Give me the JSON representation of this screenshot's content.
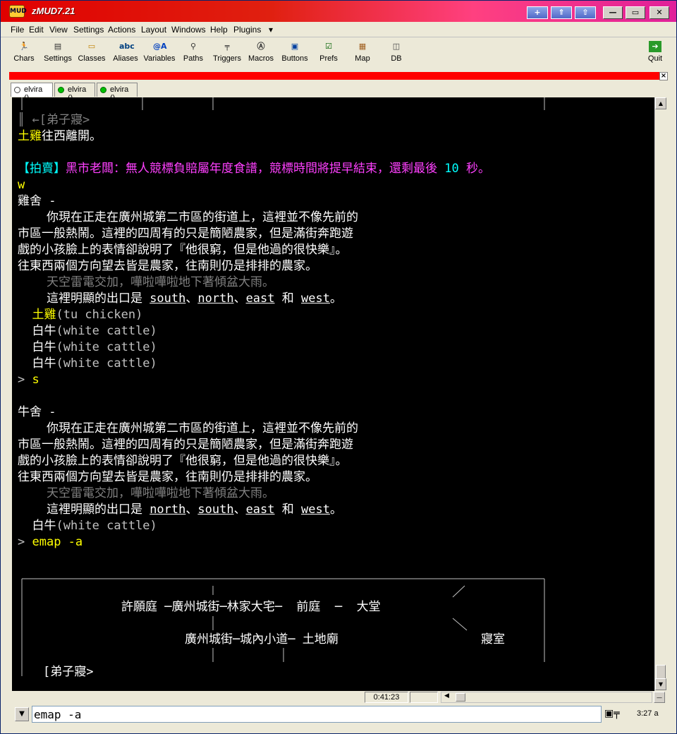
{
  "window": {
    "title": "zMUD7.21",
    "app_icon": "MUD"
  },
  "titlebar_buttons": [
    "+",
    "⇑",
    "⇧"
  ],
  "sysbuttons": [
    "—",
    "▭",
    "✕"
  ],
  "menu": [
    "File",
    "Edit",
    "View",
    "Settings",
    "Actions",
    "Layout",
    "Windows",
    "Help",
    "Plugins",
    "▾"
  ],
  "toolbar": [
    {
      "label": "Chars",
      "icon": "running-man-icon",
      "glyph": "🏃"
    },
    {
      "label": "Settings",
      "icon": "settings-icon",
      "glyph": "▤"
    },
    {
      "label": "Classes",
      "icon": "folder-icon",
      "glyph": "▭"
    },
    {
      "label": "Aliases",
      "icon": "abc-icon",
      "glyph": "abc"
    },
    {
      "label": "Variables",
      "icon": "variable-icon",
      "glyph": "@A"
    },
    {
      "label": "Paths",
      "icon": "walker-icon",
      "glyph": "⚲"
    },
    {
      "label": "Triggers",
      "icon": "gun-icon",
      "glyph": "╤"
    },
    {
      "label": "Macros",
      "icon": "key-icon",
      "glyph": "Ⓐ"
    },
    {
      "label": "Buttons",
      "icon": "button-icon",
      "glyph": "▣"
    },
    {
      "label": "Prefs",
      "icon": "checkbox-icon",
      "glyph": "☑"
    },
    {
      "label": "Map",
      "icon": "map-icon",
      "glyph": "▦"
    },
    {
      "label": "DB",
      "icon": "database-icon",
      "glyph": "◫"
    }
  ],
  "quit_label": "Quit",
  "tabs": [
    "elvira ()",
    "elvira ()",
    "elvira ()"
  ],
  "terminal_lines": [
    {
      "parts": [
        [
          "g",
          "║ ←[弟子寢>"
        ]
      ]
    },
    {
      "parts": [
        [
          "y",
          "土雞"
        ],
        [
          "w",
          "往西離開。"
        ]
      ]
    },
    {
      "parts": []
    },
    {
      "parts": [
        [
          "c",
          "【拍賣】"
        ],
        [
          "m",
          "黑市老闆：無人競標負賠屬年度食譜，競標時間將提早結束，還剩最後 "
        ],
        [
          "c",
          "10"
        ],
        [
          "m",
          " 秒。"
        ]
      ]
    },
    {
      "parts": [
        [
          "y",
          "w"
        ]
      ]
    },
    {
      "parts": [
        [
          "w",
          "雞舍 -"
        ]
      ]
    },
    {
      "parts": [
        [
          "w",
          "    你現在正走在廣州城第二市區的街道上，這裡並不像先前的"
        ]
      ]
    },
    {
      "parts": [
        [
          "w",
          "市區一般熱鬧。這裡的四周有的只是簡陋農家，但是滿街奔跑遊"
        ]
      ]
    },
    {
      "parts": [
        [
          "w",
          "戲的小孩臉上的表情卻說明了『他很窮，但是他過的很快樂』。"
        ]
      ]
    },
    {
      "parts": [
        [
          "w",
          "往東西兩個方向望去皆是農家，往南則仍是排排的農家。"
        ]
      ]
    },
    {
      "parts": [
        [
          "g",
          "    天空雷電交加，嘩啦嘩啦地下著傾盆大雨。"
        ]
      ]
    },
    {
      "parts": [
        [
          "w",
          "    這裡明顯的出口是 "
        ],
        [
          "wu",
          "south"
        ],
        [
          "w",
          "、"
        ],
        [
          "wu",
          "north"
        ],
        [
          "w",
          "、"
        ],
        [
          "wu",
          "east"
        ],
        [
          "w",
          " 和 "
        ],
        [
          "wu",
          "west"
        ],
        [
          "w",
          "。"
        ]
      ]
    },
    {
      "parts": [
        [
          "y",
          "  土雞"
        ],
        [
          "",
          "(tu chicken)"
        ]
      ]
    },
    {
      "parts": [
        [
          "w",
          "  白牛"
        ],
        [
          "",
          "(white cattle)"
        ]
      ]
    },
    {
      "parts": [
        [
          "w",
          "  白牛"
        ],
        [
          "",
          "(white cattle)"
        ]
      ]
    },
    {
      "parts": [
        [
          "w",
          "  白牛"
        ],
        [
          "",
          "(white cattle)"
        ]
      ]
    },
    {
      "parts": [
        [
          "",
          "> "
        ],
        [
          "y",
          "s"
        ]
      ]
    },
    {
      "parts": []
    },
    {
      "parts": [
        [
          "w",
          "牛舍 -"
        ]
      ]
    },
    {
      "parts": [
        [
          "w",
          "    你現在正走在廣州城第二市區的街道上，這裡並不像先前的"
        ]
      ]
    },
    {
      "parts": [
        [
          "w",
          "市區一般熱鬧。這裡的四周有的只是簡陋農家，但是滿街奔跑遊"
        ]
      ]
    },
    {
      "parts": [
        [
          "w",
          "戲的小孩臉上的表情卻說明了『他很窮，但是他過的很快樂』。"
        ]
      ]
    },
    {
      "parts": [
        [
          "w",
          "往東西兩個方向望去皆是農家，往南則仍是排排的農家。"
        ]
      ]
    },
    {
      "parts": [
        [
          "g",
          "    天空雷電交加，嘩啦嘩啦地下著傾盆大雨。"
        ]
      ]
    },
    {
      "parts": [
        [
          "w",
          "    這裡明顯的出口是 "
        ],
        [
          "wu",
          "north"
        ],
        [
          "w",
          "、"
        ],
        [
          "wu",
          "south"
        ],
        [
          "w",
          "、"
        ],
        [
          "wu",
          "east"
        ],
        [
          "w",
          " 和 "
        ],
        [
          "wu",
          "west"
        ],
        [
          "w",
          "。"
        ]
      ]
    },
    {
      "parts": [
        [
          "w",
          "  白牛"
        ],
        [
          "",
          "(white cattle)"
        ]
      ]
    },
    {
      "parts": [
        [
          "",
          "> "
        ],
        [
          "y",
          "emap -a"
        ]
      ]
    }
  ],
  "map_labels": {
    "row1": "許願庭 ─廣州城街─林家大宅─  前庭  ─  大堂",
    "row2": "廣州城街─城內小道─ 土地廟",
    "room": "寢室",
    "bottom": "[弟子寢>"
  },
  "status": {
    "time": "0:41:23",
    "clock": "3:27 a"
  },
  "input": {
    "value": "emap -a"
  }
}
